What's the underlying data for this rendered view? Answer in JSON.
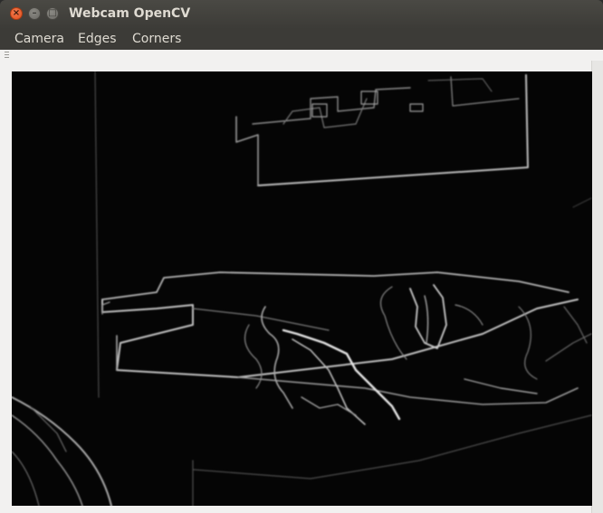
{
  "window": {
    "title": "Webcam OpenCV",
    "buttons": {
      "close_icon": "close-icon",
      "minimize_icon": "minimize-icon",
      "maximize_icon": "maximize-icon"
    }
  },
  "menubar": {
    "items": [
      {
        "label": "Camera"
      },
      {
        "label": "Edges"
      },
      {
        "label": "Corners"
      }
    ]
  },
  "colors": {
    "titlebar": "#3c3b37",
    "close_button": "#e95420",
    "menu_text": "#dfdbd2",
    "client_bg": "#f2f1f0",
    "video_bg": "#050505"
  }
}
